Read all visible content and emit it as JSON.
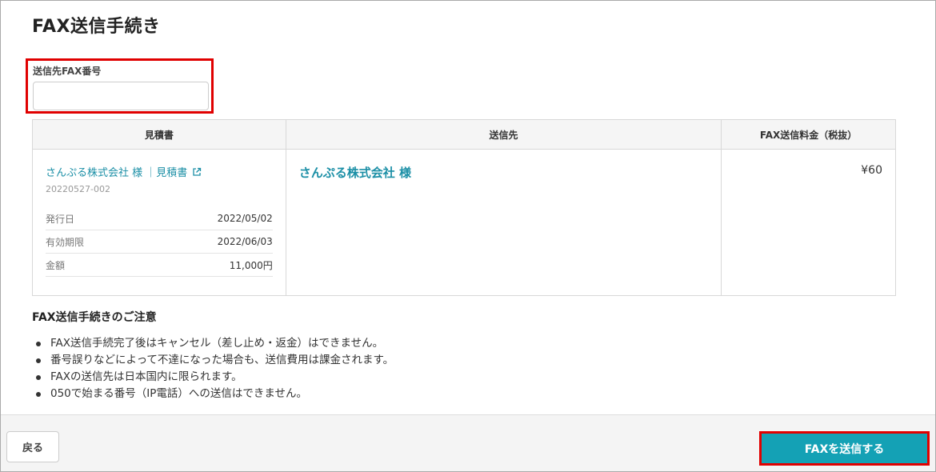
{
  "page": {
    "title": "FAX送信手続き"
  },
  "fax_field": {
    "label": "送信先FAX番号",
    "value": "",
    "placeholder": ""
  },
  "table": {
    "headers": [
      "見積書",
      "送信先",
      "FAX送信料金（税抜）"
    ],
    "quote": {
      "client_link": "さんぷる株式会社 様 ｜見積書",
      "number": "20220527-002",
      "meta": [
        {
          "key": "発行日",
          "value": "2022/05/02"
        },
        {
          "key": "有効期限",
          "value": "2022/06/03"
        },
        {
          "key": "金額",
          "value": "11,000円"
        }
      ]
    },
    "destination": "さんぷる株式会社 様",
    "fee": "¥60"
  },
  "notice": {
    "title": "FAX送信手続きのご注意",
    "items": [
      "FAX送信手続完了後はキャンセル（差し止め・返金）はできません。",
      "番号誤りなどによって不達になった場合も、送信費用は課金されます。",
      "FAXの送信先は日本国内に限られます。",
      "050で始まる番号（IP電話）への送信はできません。"
    ]
  },
  "footer": {
    "back_label": "戻る",
    "send_label": "FAXを送信する"
  },
  "colors": {
    "accent": "#14a1b5",
    "link": "#1b8fa6",
    "highlight": "#e00000"
  },
  "icons": {
    "external_link": "external-link-icon"
  }
}
